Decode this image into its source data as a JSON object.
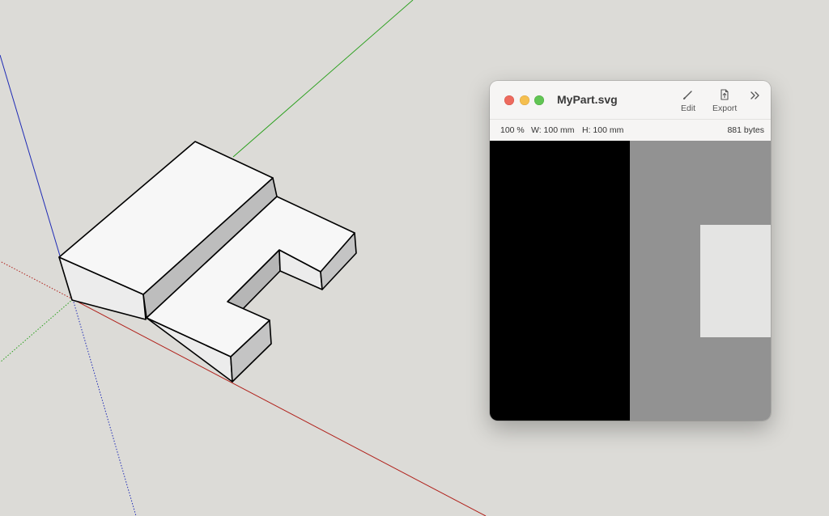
{
  "window": {
    "title": "MyPart.svg",
    "toolbar": {
      "edit_label": "Edit",
      "export_label": "Export",
      "more_icon": "chevron-double-right-icon"
    },
    "info": {
      "zoom": "100 %",
      "width": "W:  100 mm",
      "height": "H:  100 mm",
      "file_size": "881 bytes"
    }
  },
  "colors": {
    "background": "#dcdbd7",
    "x_axis": "#b0201a",
    "y_axis": "#2aa01d",
    "z_axis": "#1f2bb5",
    "model_face_top": "#f7f7f7",
    "model_face_side": "#c4c4c4",
    "preview_dark": "#000000",
    "preview_mid": "#929292",
    "preview_light": "#e4e4e3"
  }
}
